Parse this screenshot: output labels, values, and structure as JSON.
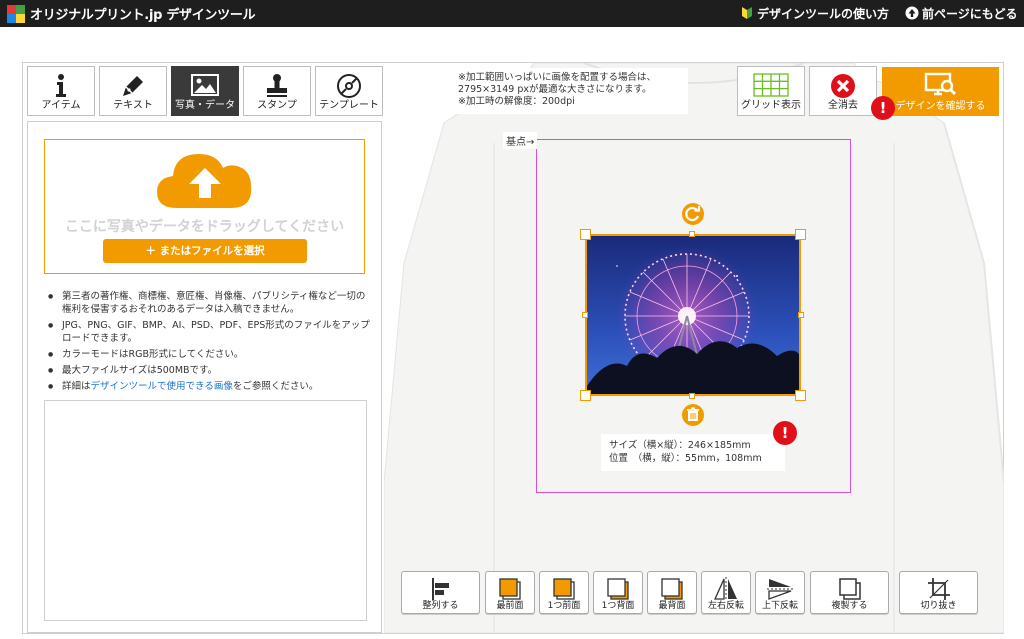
{
  "header": {
    "logo": "オリジナルプリント.jp デザインツール",
    "howto": "デザインツールの使い方",
    "back": "前ページにもどる"
  },
  "tabs": [
    {
      "label": "アイテム",
      "icon": "info-icon"
    },
    {
      "label": "テキスト",
      "icon": "pen-icon"
    },
    {
      "label": "写真・データ",
      "icon": "image-icon",
      "active": true
    },
    {
      "label": "スタンプ",
      "icon": "stamp-icon"
    },
    {
      "label": "テンプレート",
      "icon": "template-icon"
    }
  ],
  "upload": {
    "drop_text": "ここに写真やデータをドラッグしてください",
    "file_button": "＋ またはファイルを選択"
  },
  "notes": {
    "n1": "第三者の著作権、商標権、意匠権、肖像権、パブリシティ権など一切の権利を侵害するおそれのあるデータは入稿できません。",
    "n2": "JPG、PNG、GIF、BMP、AI、PSD、PDF、EPS形式のファイルをアップロードできます。",
    "n3": "カラーモードはRGB形式にしてください。",
    "n4": "最大ファイルサイズは500MBです。",
    "n5_pre": "詳細は",
    "n5_link": "デザインツールで使用できる画像",
    "n5_post": "をご参照ください。"
  },
  "info_note": {
    "line1": "※加工範囲いっぱいに画像を配置する場合は、",
    "line2": "2795×3149 pxが最適な大きさになります。",
    "line3": "※加工時の解像度：200dpi"
  },
  "top_buttons": {
    "grid": "グリッド表示",
    "clear": "全消去",
    "confirm": "デザインを確認する"
  },
  "canvas": {
    "base_point": "基点→",
    "size_line": "サイズ（横×縦）：246×185mm",
    "pos_line": "位置　（横，縦）：55mm，108mm"
  },
  "toolbar": [
    {
      "label": "整列する",
      "icon": "align-icon"
    },
    {
      "label": "最前面",
      "icon": "bring-front-icon"
    },
    {
      "label": "1つ前面",
      "icon": "bring-forward-icon"
    },
    {
      "label": "1つ背面",
      "icon": "send-backward-icon"
    },
    {
      "label": "最背面",
      "icon": "send-back-icon"
    },
    {
      "label": "左右反転",
      "icon": "flip-horizontal-icon"
    },
    {
      "label": "上下反転",
      "icon": "flip-vertical-icon"
    },
    {
      "label": "複製する",
      "icon": "duplicate-icon"
    },
    {
      "label": "切り抜き",
      "icon": "crop-icon"
    }
  ],
  "colors": {
    "accent": "#f29b00",
    "warning": "#e0101a",
    "print_area": "#d34fd3",
    "header": "#1e1e1e"
  }
}
